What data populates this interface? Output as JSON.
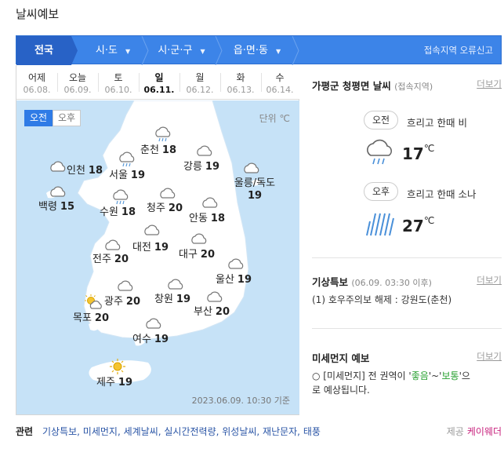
{
  "title": "날씨예보",
  "nav": {
    "items": [
      {
        "label": "전국"
      },
      {
        "label": "시·도"
      },
      {
        "label": "시·군·구"
      },
      {
        "label": "읍·면·동"
      }
    ],
    "report_label": "접속지역 오류신고"
  },
  "days": [
    {
      "name": "어제",
      "date": "06.08."
    },
    {
      "name": "오늘",
      "date": "06.09."
    },
    {
      "name": "토",
      "date": "06.10."
    },
    {
      "name": "일",
      "date": "06.11.",
      "active": true
    },
    {
      "name": "월",
      "date": "06.12."
    },
    {
      "name": "화",
      "date": "06.13."
    },
    {
      "name": "수",
      "date": "06.14."
    }
  ],
  "map": {
    "am_label": "오전",
    "pm_label": "오후",
    "unit_label": "단위 ℃",
    "timestamp": "2023.06.09. 10:30 기준",
    "colors": {
      "sea": "#c6e2f7",
      "land": "#ffffff",
      "accent": "#2f7be6"
    },
    "cities": [
      {
        "name": "춘천",
        "temp": "18",
        "icon": "rain-cloud-icon"
      },
      {
        "name": "인천",
        "temp": "18",
        "icon": "cloud-icon"
      },
      {
        "name": "서울",
        "temp": "19",
        "icon": "rain-cloud-icon"
      },
      {
        "name": "강릉",
        "temp": "19",
        "icon": "cloud-icon"
      },
      {
        "name": "울릉/독도",
        "temp": "19",
        "icon": "cloud-icon"
      },
      {
        "name": "백령",
        "temp": "15",
        "icon": "cloud-icon"
      },
      {
        "name": "수원",
        "temp": "18",
        "icon": "rain-cloud-icon"
      },
      {
        "name": "청주",
        "temp": "20",
        "icon": "cloud-icon"
      },
      {
        "name": "안동",
        "temp": "18",
        "icon": "cloud-icon"
      },
      {
        "name": "대전",
        "temp": "19",
        "icon": "cloud-icon"
      },
      {
        "name": "전주",
        "temp": "20",
        "icon": "cloud-icon"
      },
      {
        "name": "대구",
        "temp": "20",
        "icon": "cloud-icon"
      },
      {
        "name": "울산",
        "temp": "19",
        "icon": "cloud-icon"
      },
      {
        "name": "광주",
        "temp": "20",
        "icon": "cloud-icon"
      },
      {
        "name": "창원",
        "temp": "19",
        "icon": "cloud-icon"
      },
      {
        "name": "부산",
        "temp": "20",
        "icon": "cloud-icon"
      },
      {
        "name": "목포",
        "temp": "20",
        "icon": "sun-cloud-icon"
      },
      {
        "name": "여수",
        "temp": "19",
        "icon": "cloud-icon"
      },
      {
        "name": "제주",
        "temp": "19",
        "icon": "sun-icon"
      }
    ]
  },
  "local": {
    "title": "가평군 청평면 날씨",
    "subtitle": "(접속지역)",
    "more": "더보기",
    "am": {
      "label": "오전",
      "desc": "흐리고 한때 비",
      "temp": "17",
      "unit": "℃",
      "icon": "rain-cloud-icon"
    },
    "pm": {
      "label": "오후",
      "desc": "흐리고 한때 소나",
      "temp": "27",
      "unit": "℃",
      "icon": "heavy-rain-icon"
    }
  },
  "warning": {
    "title": "기상특보",
    "time": "(06.09. 03:30 이후)",
    "more": "더보기",
    "text": "(1) 호우주의보 해제 : 강원도(춘천)"
  },
  "dust": {
    "title": "미세먼지 예보",
    "more": "더보기",
    "t1": "○ [미세먼지] 전 권역이 '",
    "good": "좋음",
    "t2": "'~'",
    "normal": "보통",
    "t3": "'으",
    "line2": "로 예상됩니다."
  },
  "footer": {
    "label": "관련",
    "links": "기상특보, 미세먼지, 세계날씨, 실시간전력량, 위성날씨, 재난문자, 태풍",
    "provider_label": "제공",
    "provider": "케이웨더"
  }
}
